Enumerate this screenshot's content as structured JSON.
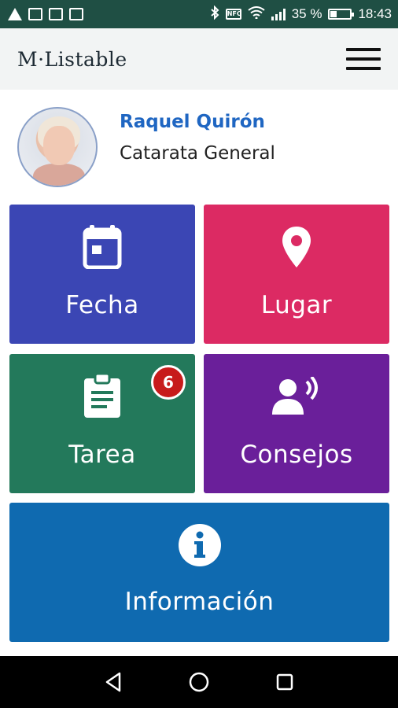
{
  "statusbar": {
    "battery_text": "35 %",
    "time": "18:43",
    "battery_level": 0.35,
    "nfc_label": "NFC"
  },
  "appbar": {
    "logo": "M·Listable"
  },
  "profile": {
    "name": "Raquel Quirón",
    "subtitle": "Catarata General"
  },
  "tiles": {
    "fecha": {
      "label": "Fecha",
      "color": "#3b46b4",
      "icon": "calendar-icon"
    },
    "lugar": {
      "label": "Lugar",
      "color": "#dc2a63",
      "icon": "location-pin-icon"
    },
    "tarea": {
      "label": "Tarea",
      "color": "#23795b",
      "icon": "clipboard-icon",
      "badge": "6"
    },
    "consejos": {
      "label": "Consejos",
      "color": "#6a1f9a",
      "icon": "speaking-person-icon"
    },
    "informacion": {
      "label": "Información",
      "color": "#0f6ab0",
      "icon": "info-icon"
    }
  },
  "navbar": {
    "back": "back-icon",
    "home": "home-icon",
    "recents": "recents-icon"
  }
}
